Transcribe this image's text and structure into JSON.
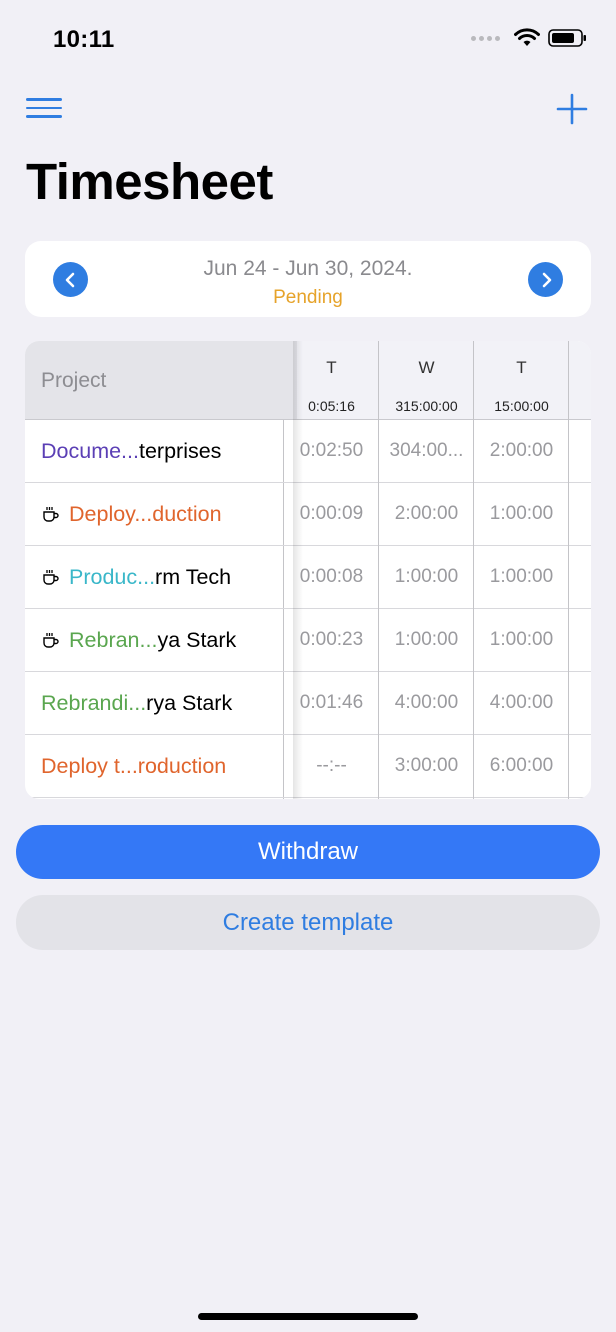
{
  "status_bar": {
    "time": "10:11"
  },
  "page": {
    "title": "Timesheet"
  },
  "week": {
    "range": "Jun 24 - Jun 30, 2024.",
    "status": "Pending",
    "status_color": "#e6a32a"
  },
  "table": {
    "project_header": "Project",
    "days": [
      {
        "letter": "T",
        "total": "0:05:16",
        "cells": [
          "0:02:50",
          "0:00:09",
          "0:00:08",
          "0:00:23",
          "0:01:46",
          "--:--"
        ]
      },
      {
        "letter": "W",
        "total": "315:00:00",
        "cells": [
          "304:00...",
          "2:00:00",
          "1:00:00",
          "1:00:00",
          "4:00:00",
          "3:00:00"
        ]
      },
      {
        "letter": "T",
        "total": "15:00:00",
        "cells": [
          "2:00:00",
          "1:00:00",
          "1:00:00",
          "1:00:00",
          "4:00:00",
          "6:00:00"
        ]
      }
    ],
    "rows": [
      {
        "colored": "Docume...",
        "rest": "terprises",
        "color": "#5b3fb5",
        "break_icon": false
      },
      {
        "colored": "Deploy...duction",
        "rest": "",
        "color": "#e0652d",
        "break_icon": true
      },
      {
        "colored": "Produc...",
        "rest": "rm Tech",
        "color": "#3ab7c9",
        "break_icon": true
      },
      {
        "colored": "Rebran...",
        "rest": "ya Stark",
        "color": "#5aa64f",
        "break_icon": true
      },
      {
        "colored": "Rebrandi...",
        "rest": "rya Stark",
        "color": "#5aa64f",
        "break_icon": false
      },
      {
        "colored": "Deploy t...roduction",
        "rest": "",
        "color": "#e0652d",
        "break_icon": false
      }
    ]
  },
  "actions": {
    "withdraw": "Withdraw",
    "create_template": "Create template"
  },
  "colors": {
    "accent": "#2f7de1",
    "primary_button": "#3478f6",
    "background": "#f1f0f6"
  }
}
